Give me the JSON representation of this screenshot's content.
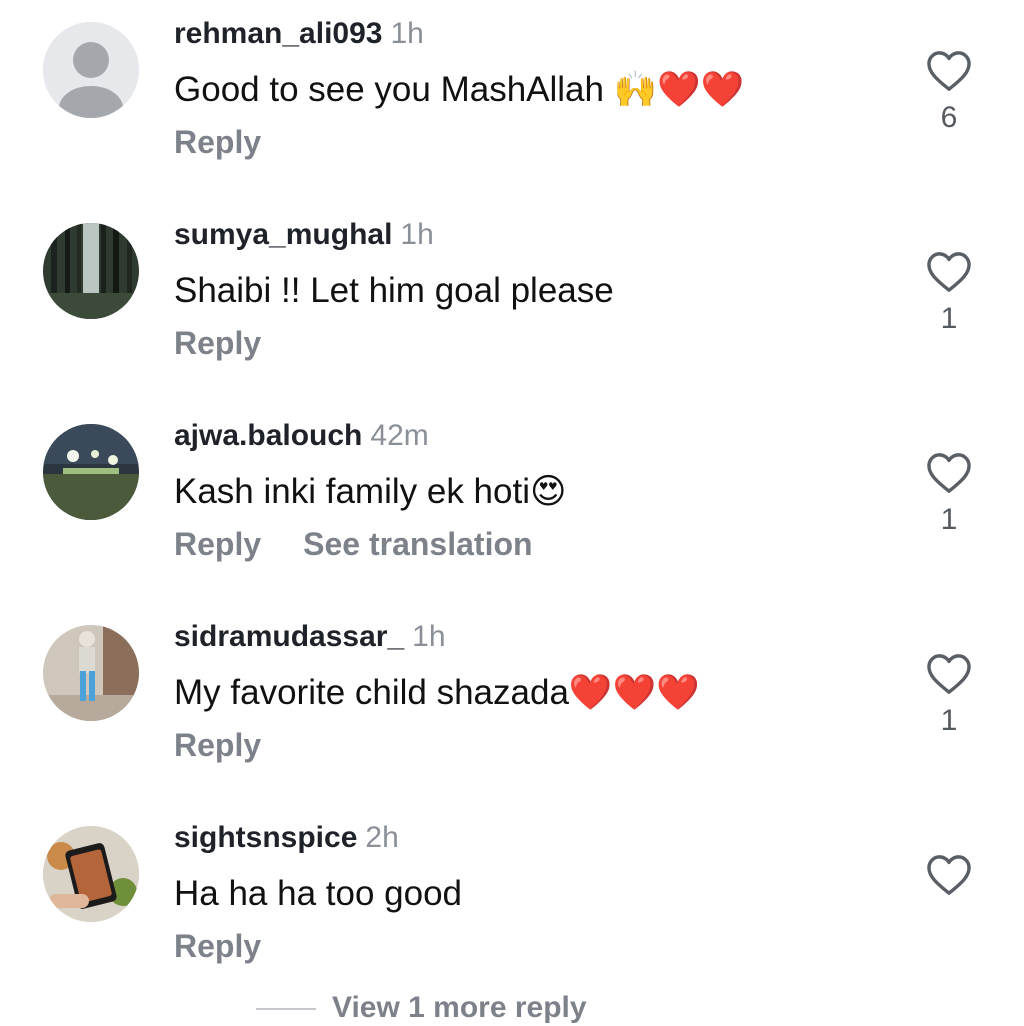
{
  "comments": [
    {
      "username": "rehman_ali093",
      "time": "1h",
      "text": "Good to see you MashAllah 🙌❤️❤️",
      "reply": "Reply",
      "likes": "6",
      "avatar": "default-person"
    },
    {
      "username": "sumya_mughal",
      "time": "1h",
      "text": "Shaibi !! Let him goal please",
      "reply": "Reply",
      "likes": "1",
      "avatar": "forest-photo"
    },
    {
      "username": "ajwa.balouch",
      "time": "42m",
      "text": "Kash inki family ek hoti😍",
      "reply": "Reply",
      "see_translation": "See translation",
      "likes": "1",
      "avatar": "night-lights-photo"
    },
    {
      "username": "sidramudassar_",
      "time": "1h",
      "text": "My favorite child shazada❤️❤️❤️",
      "reply": "Reply",
      "likes": "1",
      "avatar": "person-photo"
    },
    {
      "username": "sightsnspice",
      "time": "2h",
      "text": "Ha ha ha too good",
      "reply": "Reply",
      "likes": "",
      "avatar": "food-phone-photo"
    }
  ],
  "view_more_replies": "View 1 more reply",
  "colors": {
    "username": "#1f2329",
    "muted": "#7d828a",
    "text": "#111111"
  }
}
